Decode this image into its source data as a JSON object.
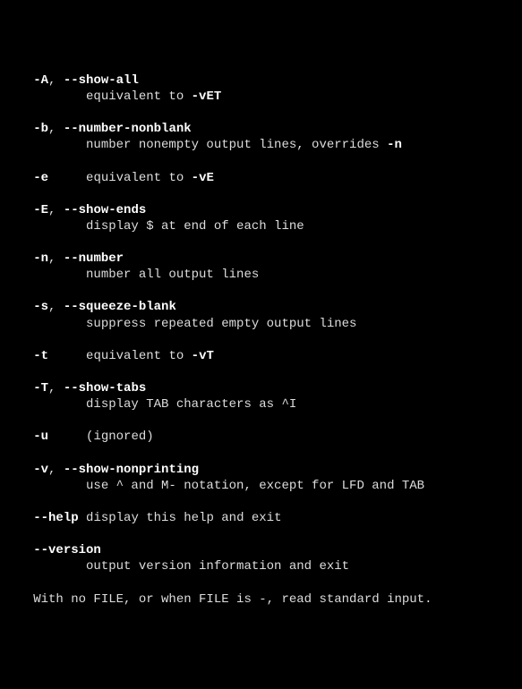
{
  "options": [
    {
      "line1": [
        {
          "t": "   ",
          "b": false
        },
        {
          "t": "-A",
          "b": true
        },
        {
          "t": ", ",
          "b": false
        },
        {
          "t": "--show-all",
          "b": true
        }
      ],
      "line2": [
        {
          "t": "          equivalent to ",
          "b": false
        },
        {
          "t": "-vET",
          "b": true
        }
      ]
    },
    {
      "line1": [
        {
          "t": "   ",
          "b": false
        },
        {
          "t": "-b",
          "b": true
        },
        {
          "t": ", ",
          "b": false
        },
        {
          "t": "--number-nonblank",
          "b": true
        }
      ],
      "line2": [
        {
          "t": "          number nonempty output lines, overrides ",
          "b": false
        },
        {
          "t": "-n",
          "b": true
        }
      ]
    },
    {
      "line1": [
        {
          "t": "   ",
          "b": false
        },
        {
          "t": "-e",
          "b": true
        },
        {
          "t": "     equivalent to ",
          "b": false
        },
        {
          "t": "-vE",
          "b": true
        }
      ],
      "line2": null
    },
    {
      "line1": [
        {
          "t": "   ",
          "b": false
        },
        {
          "t": "-E",
          "b": true
        },
        {
          "t": ", ",
          "b": false
        },
        {
          "t": "--show-ends",
          "b": true
        }
      ],
      "line2": [
        {
          "t": "          display $ at end of each line",
          "b": false
        }
      ]
    },
    {
      "line1": [
        {
          "t": "   ",
          "b": false
        },
        {
          "t": "-n",
          "b": true
        },
        {
          "t": ", ",
          "b": false
        },
        {
          "t": "--number",
          "b": true
        }
      ],
      "line2": [
        {
          "t": "          number all output lines",
          "b": false
        }
      ]
    },
    {
      "line1": [
        {
          "t": "   ",
          "b": false
        },
        {
          "t": "-s",
          "b": true
        },
        {
          "t": ", ",
          "b": false
        },
        {
          "t": "--squeeze-blank",
          "b": true
        }
      ],
      "line2": [
        {
          "t": "          suppress repeated empty output lines",
          "b": false
        }
      ]
    },
    {
      "line1": [
        {
          "t": "   ",
          "b": false
        },
        {
          "t": "-t",
          "b": true
        },
        {
          "t": "     equivalent to ",
          "b": false
        },
        {
          "t": "-vT",
          "b": true
        }
      ],
      "line2": null
    },
    {
      "line1": [
        {
          "t": "   ",
          "b": false
        },
        {
          "t": "-T",
          "b": true
        },
        {
          "t": ", ",
          "b": false
        },
        {
          "t": "--show-tabs",
          "b": true
        }
      ],
      "line2": [
        {
          "t": "          display TAB characters as ^I",
          "b": false
        }
      ]
    },
    {
      "line1": [
        {
          "t": "   ",
          "b": false
        },
        {
          "t": "-u",
          "b": true
        },
        {
          "t": "     (ignored)",
          "b": false
        }
      ],
      "line2": null
    },
    {
      "line1": [
        {
          "t": "   ",
          "b": false
        },
        {
          "t": "-v",
          "b": true
        },
        {
          "t": ", ",
          "b": false
        },
        {
          "t": "--show-nonprinting",
          "b": true
        }
      ],
      "line2": [
        {
          "t": "          use ^ and M- notation, except for LFD and TAB",
          "b": false
        }
      ]
    },
    {
      "line1": [
        {
          "t": "   ",
          "b": false
        },
        {
          "t": "--help",
          "b": true
        },
        {
          "t": " display this help and exit",
          "b": false
        }
      ],
      "line2": null
    },
    {
      "line1": [
        {
          "t": "   ",
          "b": false
        },
        {
          "t": "--version",
          "b": true
        }
      ],
      "line2": [
        {
          "t": "          output version information and exit",
          "b": false
        }
      ]
    }
  ],
  "footer": "   With no FILE, or when FILE is -, read standard input."
}
